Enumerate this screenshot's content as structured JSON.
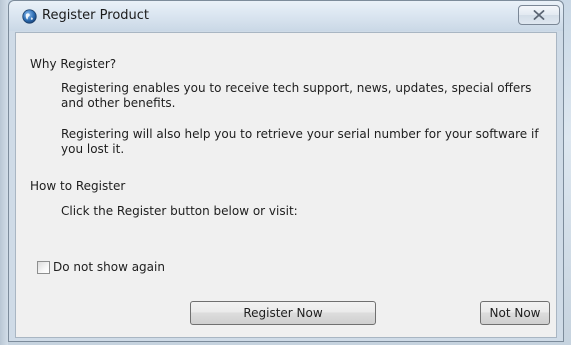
{
  "window": {
    "title": "Register Product",
    "close_glyph": "X"
  },
  "content": {
    "why_heading": "Why Register?",
    "why_para1": "Registering enables you to receive tech support, news, updates, special offers and other benefits.",
    "why_para2": "Registering will also help you to retrieve your serial number for your software if you lost it.",
    "how_heading": "How to Register",
    "how_text": "Click the Register button below or visit:"
  },
  "checkbox": {
    "label": "Do not show again",
    "checked": false
  },
  "buttons": {
    "register": "Register Now",
    "not_now": "Not Now"
  },
  "icons": {
    "app": "globe-icon",
    "close": "close-icon"
  },
  "colors": {
    "client_bg": "#f0f0f0",
    "titlebar": "#dbe6f1",
    "app_icon_blue": "#2a5c9a"
  }
}
